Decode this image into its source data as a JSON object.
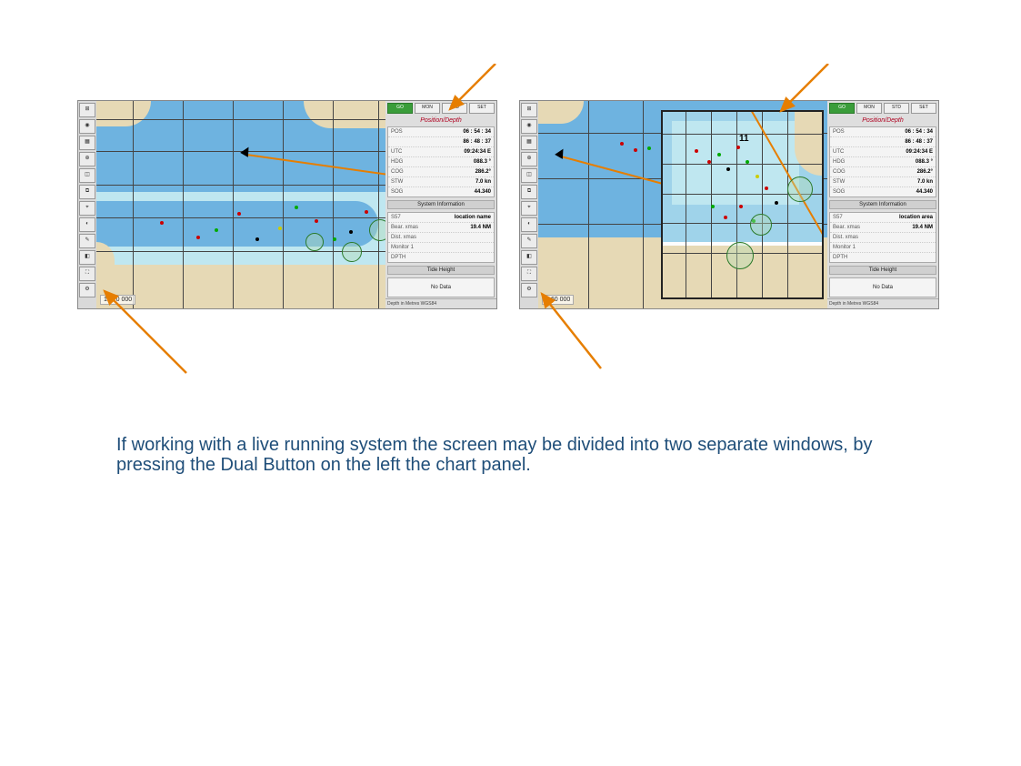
{
  "caption": "If working with a live running system the screen may be divided into two separate windows, by pressing the Dual Button on the left the chart panel.",
  "figure_left": {
    "scale": "1:420 000",
    "panel": {
      "title": "Position/Depth",
      "buttons": {
        "go": "GO",
        "b1": "MON",
        "b2": "STD",
        "b3": "SET"
      },
      "pos_lat": "06 : 54 : 34",
      "pos_lon": "86 : 48 : 37",
      "pos": "POS",
      "utc": "UTC",
      "utc_val": "09:24:34 E",
      "hdg": "HDG",
      "hdg_val": "088.3 °",
      "cog": "COG",
      "cog_val": "286.2°",
      "stw": "STW",
      "stw_val": "7.0 kn",
      "sog": "SOG",
      "sog_val": "44.340",
      "sysinfo_title": "System Information",
      "sel": "S57",
      "location": "location name",
      "dist": "19.4 NM",
      "bear": "Bear. xmas",
      "dist2": "Dist. xmas",
      "monit": "Monitor 1",
      "dpth": "DPTH",
      "tide_title": "Tide Height",
      "no_data": "No Data",
      "footer": "Depth in Metres   WGS84"
    }
  },
  "figure_right": {
    "scale": "1:60 000",
    "panel": {
      "title": "Position/Depth",
      "buttons": {
        "go": "GO",
        "b1": "MON",
        "b2": "STD",
        "b3": "SET"
      },
      "pos_lat": "06 : 54 : 34",
      "pos_lon": "86 : 48 : 37",
      "pos": "POS",
      "utc": "UTC",
      "utc_val": "09:24:34 E",
      "hdg": "HDG",
      "hdg_val": "088.3 °",
      "cog": "COG",
      "cog_val": "286.2°",
      "stw": "STW",
      "stw_val": "7.0 kn",
      "sog": "SOG",
      "sog_val": "44.340",
      "sysinfo_title": "System Information",
      "sel": "S57",
      "location": "location area",
      "dist": "19.4 NM",
      "bear": "Bear. xmas",
      "dist2": "Dist. xmas",
      "monit": "Monitor 1",
      "dpth": "DPTH",
      "tide_title": "Tide Height",
      "no_data": "No Data",
      "footer": "Depth in Metres   WGS84"
    }
  },
  "colors": {
    "arrow": "#e67e00"
  }
}
